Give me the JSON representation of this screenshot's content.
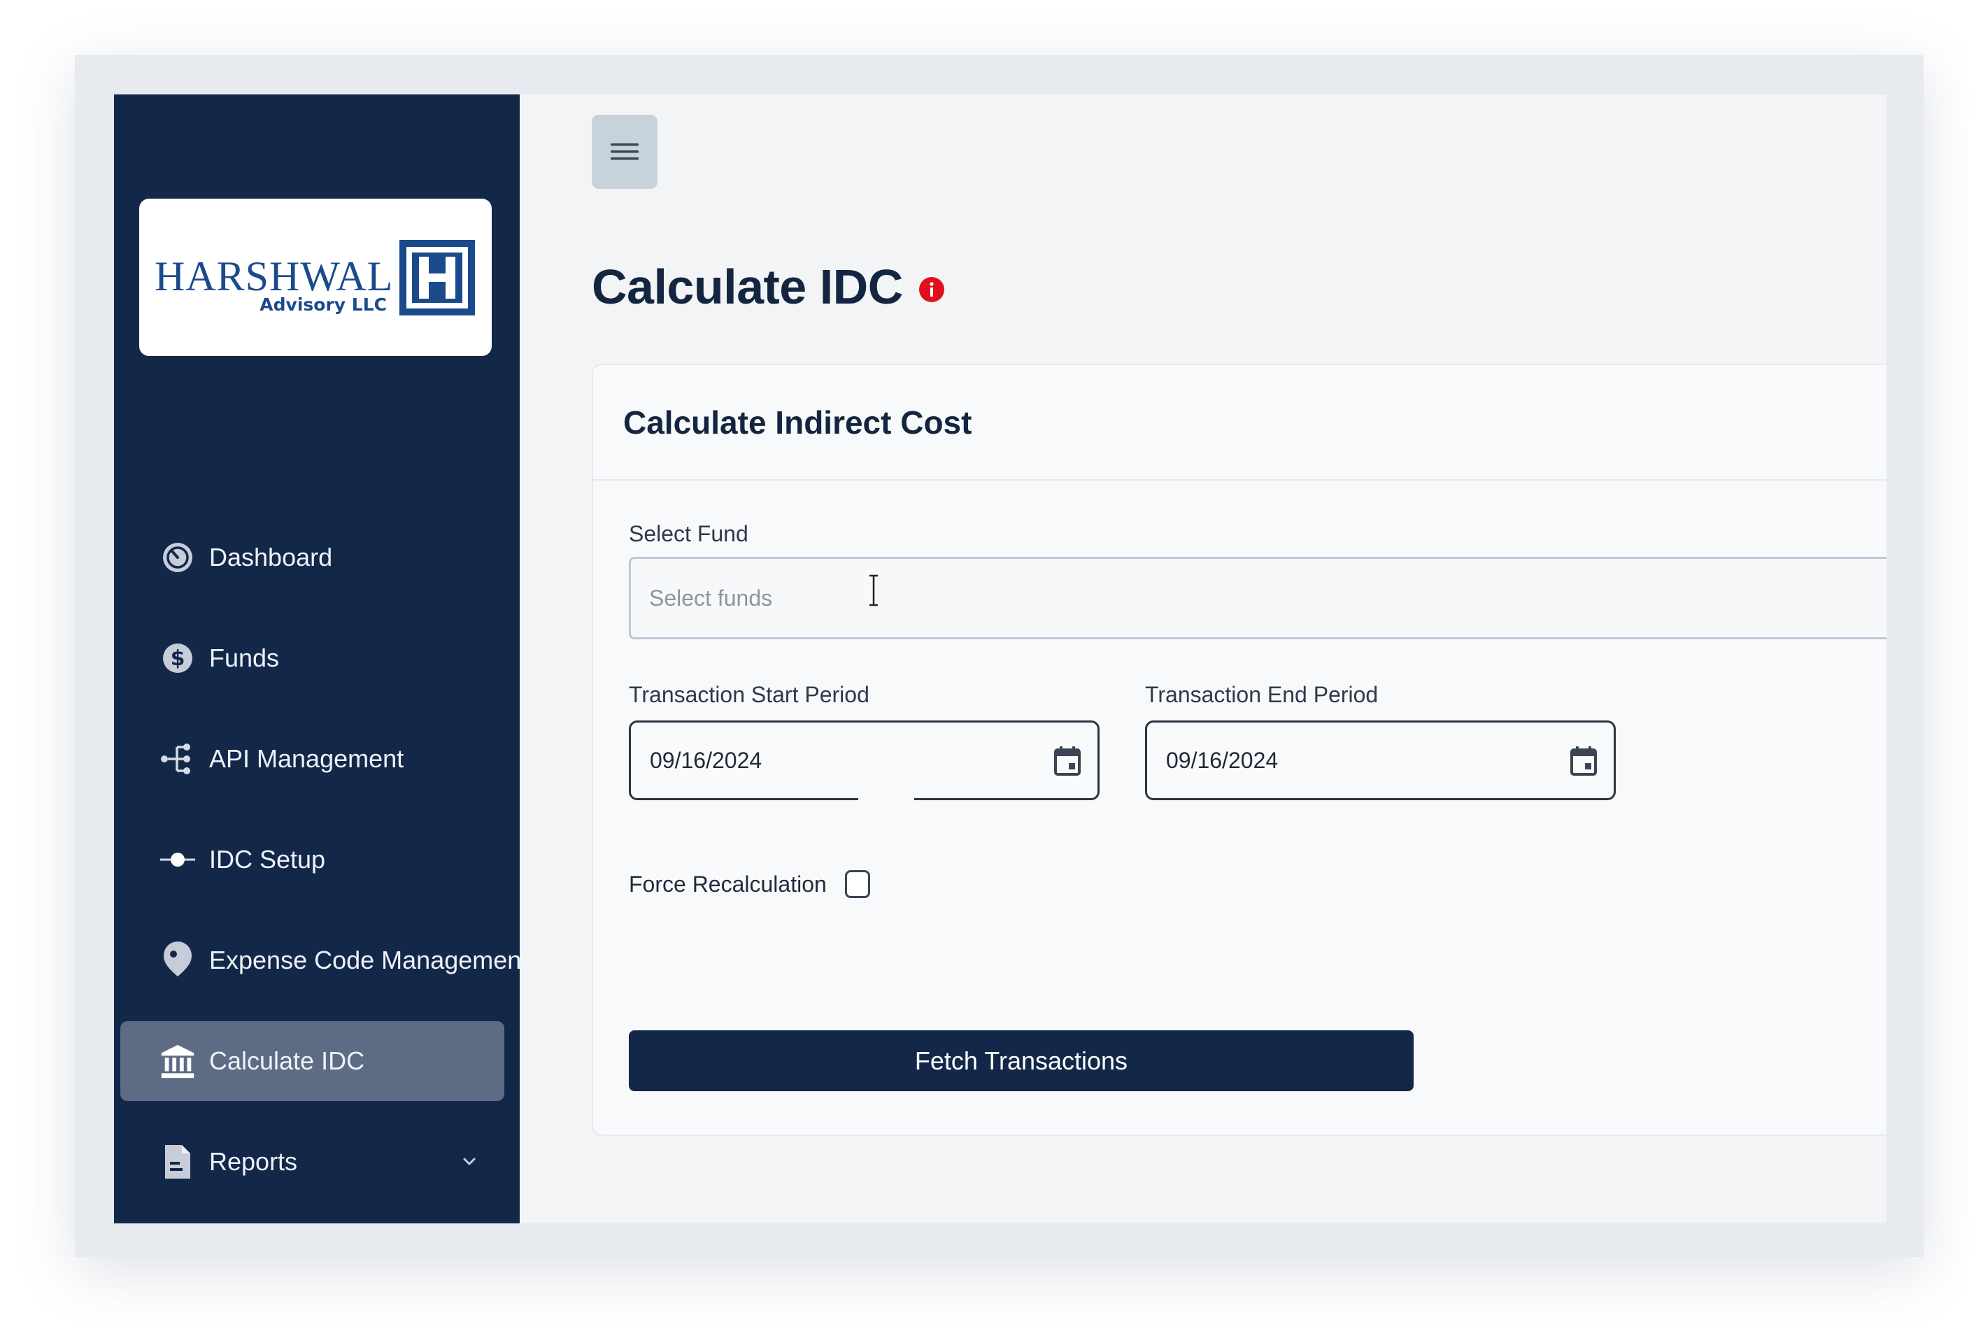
{
  "colors": {
    "sidebar_bg": "#132849",
    "active_item_bg": "#5d6c84",
    "main_bg": "#f3f4f6",
    "primary_button": "#132849",
    "info_badge": "#e0101d",
    "logo_blue": "#1b4a8c"
  },
  "sidebar": {
    "logo": {
      "name": "HARSHWAL",
      "sub": "Advisory LLC",
      "mark_letter": "H"
    },
    "items": [
      {
        "label": "Dashboard",
        "icon": "dashboard-icon",
        "active": false
      },
      {
        "label": "Funds",
        "icon": "dollar-icon",
        "active": false
      },
      {
        "label": "API Management",
        "icon": "api-tree-icon",
        "active": false
      },
      {
        "label": "IDC Setup",
        "icon": "setup-node-icon",
        "active": false
      },
      {
        "label": "Expense Code Management",
        "icon": "tag-icon",
        "active": false
      },
      {
        "label": "Calculate IDC",
        "icon": "bank-icon",
        "active": true
      },
      {
        "label": "Reports",
        "icon": "report-icon",
        "active": false,
        "expandable": true
      }
    ]
  },
  "header": {
    "menu_icon": "hamburger-icon"
  },
  "page": {
    "title": "Calculate IDC",
    "info_icon": "info-icon"
  },
  "card": {
    "title": "Calculate Indirect Cost",
    "fund": {
      "label": "Select Fund",
      "placeholder": "Select funds",
      "value": ""
    },
    "start": {
      "label": "Transaction Start Period",
      "value": "09/16/2024"
    },
    "end": {
      "label": "Transaction End Period",
      "value": "09/16/2024"
    },
    "force": {
      "label": "Force Recalculation",
      "checked": false
    },
    "fetch_label": "Fetch Transactions"
  }
}
